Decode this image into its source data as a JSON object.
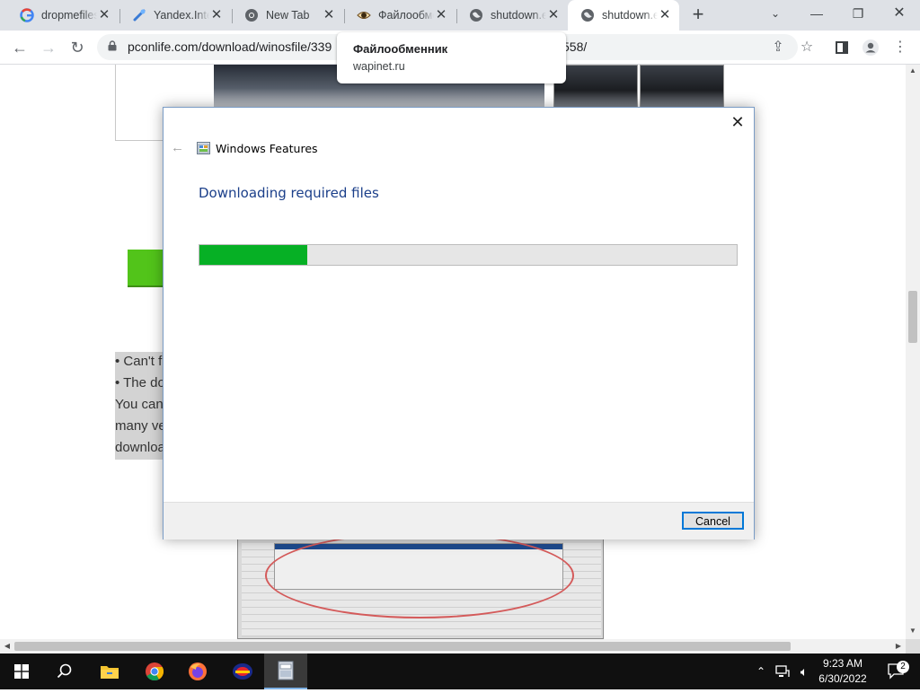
{
  "browser": {
    "tabs": [
      {
        "title": "dropmefiles",
        "icon": "google-icon",
        "active": false
      },
      {
        "title": "Yandex.Internet",
        "icon": "yandex-icon",
        "active": false
      },
      {
        "title": "New Tab",
        "icon": "chrome-icon",
        "active": false
      },
      {
        "title": "Файлообменник",
        "icon": "eye-icon",
        "active": false
      },
      {
        "title": "shutdown.exe",
        "icon": "globe-icon",
        "active": false
      },
      {
        "title": "shutdown.exe",
        "icon": "globe-icon",
        "active": true
      }
    ],
    "new_tab": "+",
    "url_left": "pconlife.com/download/winosfile/339",
    "url_right": "558/",
    "tooltip": {
      "title": "Файлообменник",
      "domain": "wapinet.ru"
    }
  },
  "page": {
    "lines": [
      "• Can't f",
      "• The do",
      "You can",
      "many ve",
      "downloa"
    ]
  },
  "dialog": {
    "title": "Windows Features",
    "heading": "Downloading required files",
    "progress": 0.2,
    "cancel_label": "Cancel",
    "progress_color": "#06b025"
  },
  "taskbar": {
    "apps": [
      "start-icon",
      "search-icon",
      "file-explorer-icon",
      "chrome-icon",
      "firefox-icon",
      "app-icon",
      "windows-features-icon"
    ],
    "time": "9:23 AM",
    "date": "6/30/2022",
    "notifications": "2"
  }
}
